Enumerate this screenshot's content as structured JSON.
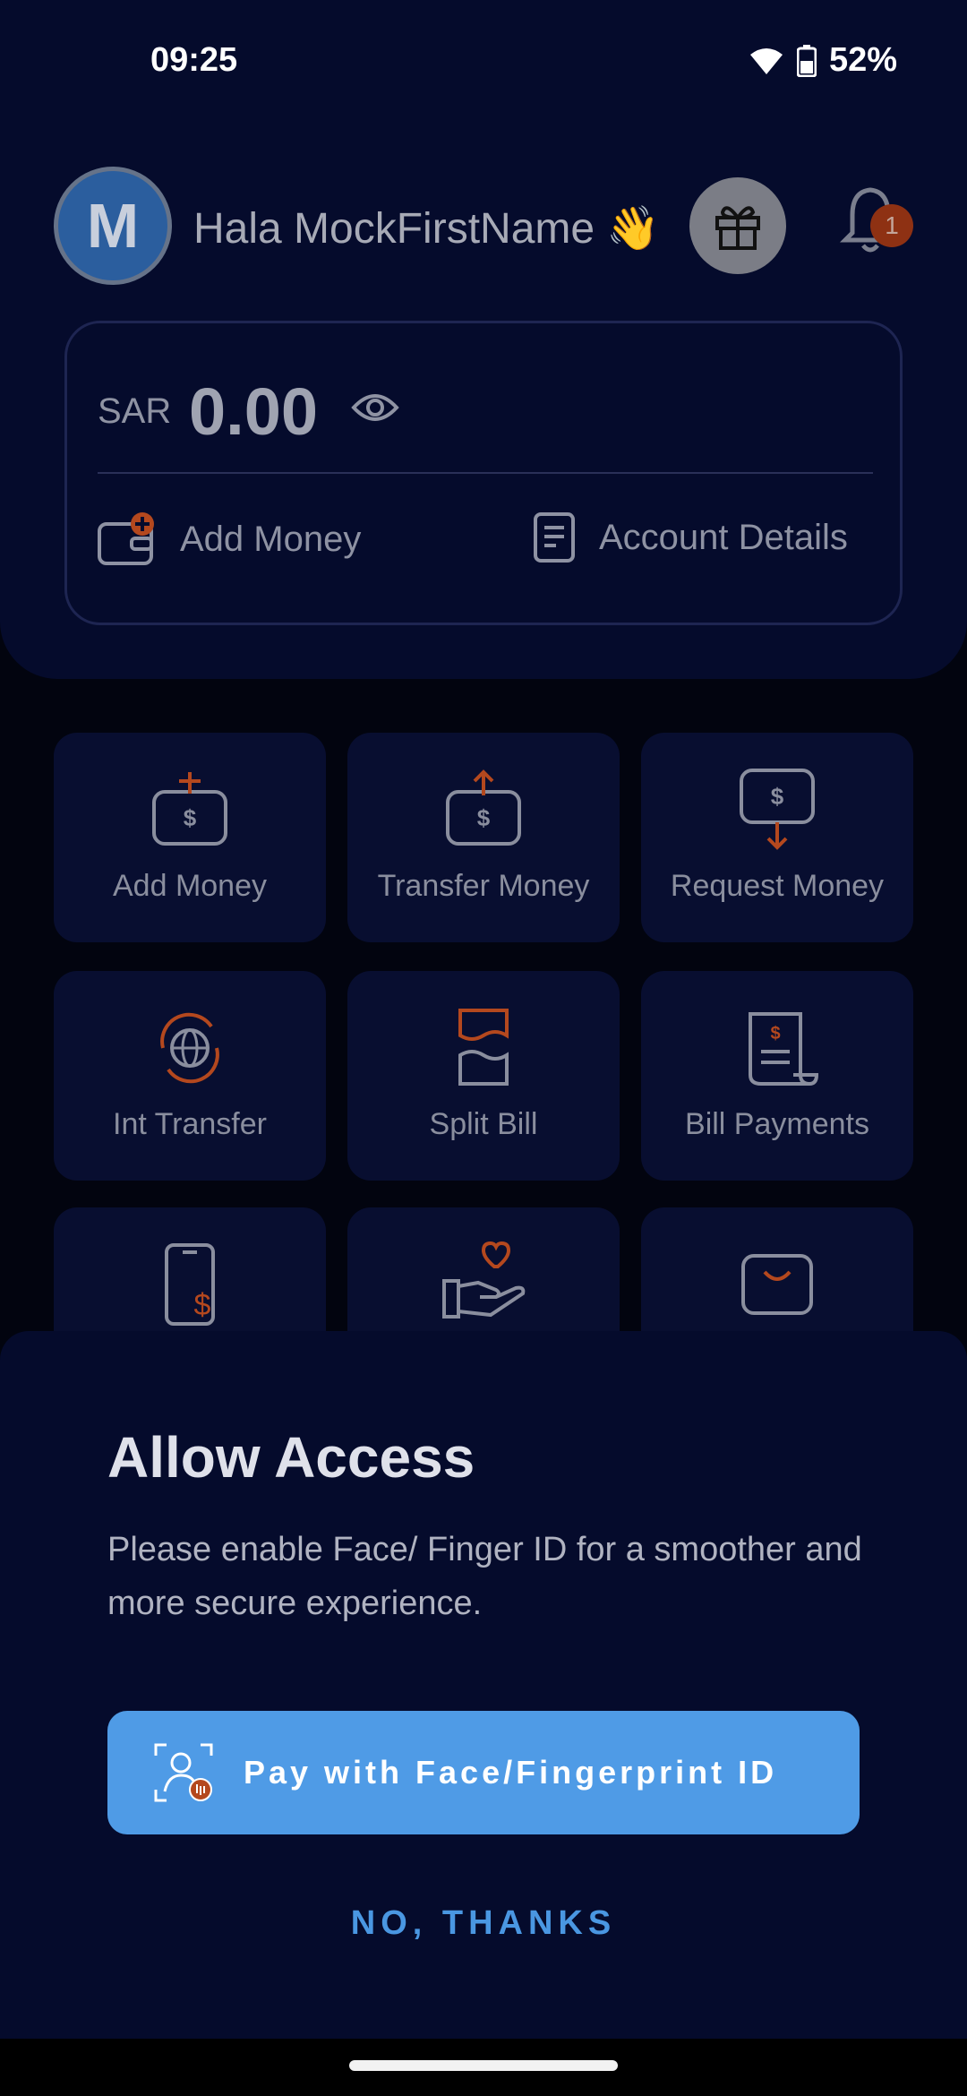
{
  "status": {
    "time": "09:25",
    "battery": "52%"
  },
  "header": {
    "avatar_initial": "M",
    "greeting": "Hala MockFirstName 👋",
    "notification_count": "1"
  },
  "balance": {
    "currency": "SAR",
    "amount": "0.00",
    "add_money": "Add Money",
    "account_details": "Account Details"
  },
  "tiles": [
    {
      "label": "Add Money",
      "icon": "add-money-icon"
    },
    {
      "label": "Transfer Money",
      "icon": "transfer-money-icon"
    },
    {
      "label": "Request Money",
      "icon": "request-money-icon"
    },
    {
      "label": "Int Transfer",
      "icon": "globe-icon"
    },
    {
      "label": "Split Bill",
      "icon": "split-bill-icon"
    },
    {
      "label": "Bill Payments",
      "icon": "bill-receipt-icon"
    },
    {
      "label": "",
      "icon": "mobile-payment-icon"
    },
    {
      "label": "",
      "icon": "donation-hand-icon"
    },
    {
      "label": "",
      "icon": "shopping-bag-icon"
    }
  ],
  "sheet": {
    "title": "Allow Access",
    "description": "Please enable Face/ Finger ID for a smoother and more secure experience.",
    "primary_label": "Pay with Face/Fingerprint ID",
    "secondary_label": "NO, THANKS"
  },
  "colors": {
    "accent": "#4f9be6",
    "icon_orange": "#b4481e",
    "icon_gray": "#8a8e9e",
    "background": "#050b2c"
  }
}
